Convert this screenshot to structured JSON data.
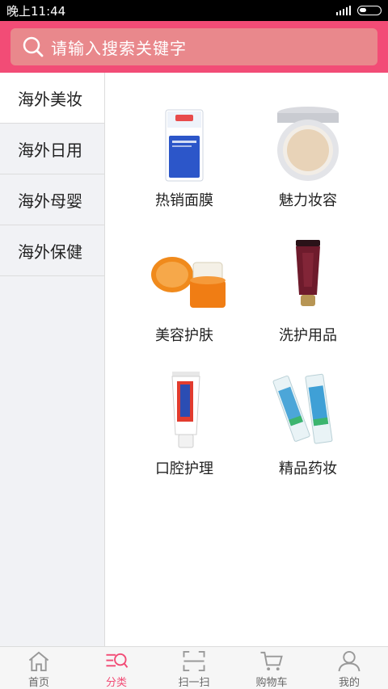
{
  "status_bar": {
    "time": "晚上11:44"
  },
  "search": {
    "placeholder": "请输入搜索关键字"
  },
  "sidebar": {
    "items": [
      {
        "label": "海外美妆"
      },
      {
        "label": "海外日用"
      },
      {
        "label": "海外母婴"
      },
      {
        "label": "海外保健"
      }
    ],
    "active_index": 0
  },
  "grid": {
    "items": [
      {
        "label": "热销面膜",
        "icon": "mask-pack-icon"
      },
      {
        "label": "魅力妆容",
        "icon": "cushion-compact-icon"
      },
      {
        "label": "美容护肤",
        "icon": "cream-jar-icon"
      },
      {
        "label": "洗护用品",
        "icon": "tube-product-icon"
      },
      {
        "label": "口腔护理",
        "icon": "toothpaste-icon"
      },
      {
        "label": "精品药妆",
        "icon": "toothpaste-pair-icon"
      }
    ]
  },
  "tabbar": {
    "items": [
      {
        "label": "首页",
        "icon": "home-icon"
      },
      {
        "label": "分类",
        "icon": "category-icon"
      },
      {
        "label": "扫一扫",
        "icon": "scan-icon"
      },
      {
        "label": "购物车",
        "icon": "cart-icon"
      },
      {
        "label": "我的",
        "icon": "user-icon"
      }
    ],
    "active_index": 1
  },
  "colors": {
    "brand": "#f24c76",
    "search_bg": "#e9888c",
    "sidebar_bg": "#f1f2f5"
  }
}
